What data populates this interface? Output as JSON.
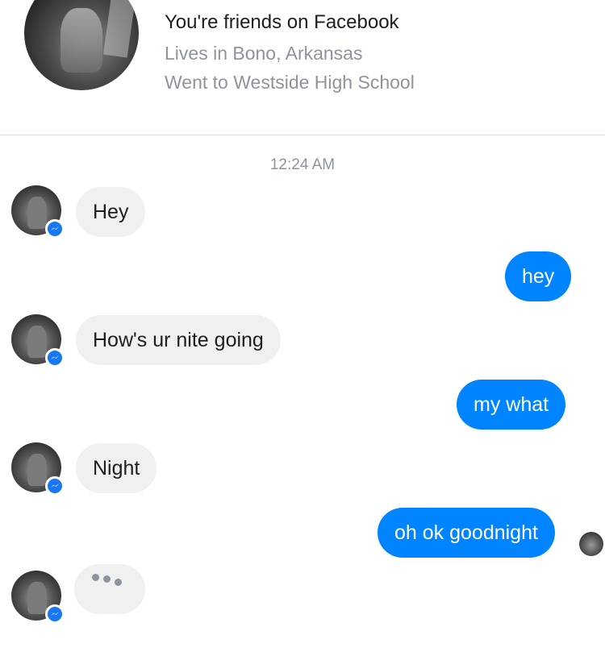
{
  "profile": {
    "friends_text": "You're friends on Facebook",
    "lives_text": "Lives in Bono, Arkansas",
    "school_text": "Went to Westside High School"
  },
  "timestamp": "12:24 AM",
  "messages": [
    {
      "sender": "them",
      "text": "Hey"
    },
    {
      "sender": "me",
      "text": "hey"
    },
    {
      "sender": "them",
      "text": "How's ur nite going"
    },
    {
      "sender": "me",
      "text": "my what"
    },
    {
      "sender": "them",
      "text": "Night"
    },
    {
      "sender": "me",
      "text": "oh ok goodnight"
    }
  ],
  "typing_indicator": true,
  "colors": {
    "outgoing_bubble": "#0084ff",
    "incoming_bubble": "#f1f0f0",
    "messenger_badge": "#1877f2",
    "secondary_text": "#8d949e"
  },
  "icons": {
    "profile": "profile-photo",
    "avatar": "contact-avatar",
    "badge": "messenger-icon",
    "read_receipt": "read-receipt-avatar"
  }
}
